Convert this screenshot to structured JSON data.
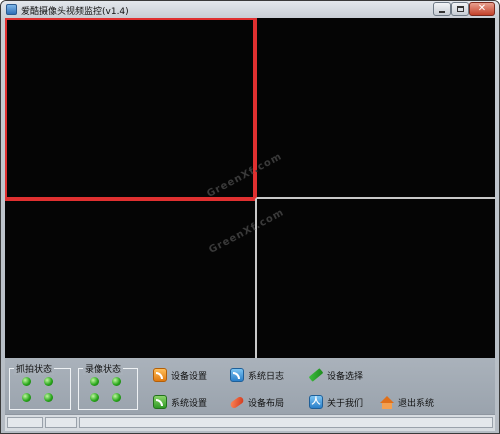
{
  "window": {
    "title": "爱酷摄像头视频监控(v1.4)",
    "icons": {
      "app": "app-icon",
      "minimize": "minimize-icon",
      "maximize": "maximize-icon",
      "close": "close-icon"
    },
    "close_glyph": "✕"
  },
  "video": {
    "panes": [
      "pane-1",
      "pane-2",
      "pane-3",
      "pane-4"
    ],
    "selected_pane": 1,
    "selected_border_color": "#e03030",
    "grid_color": "#c8c8c8",
    "watermark": "GreenXf.com"
  },
  "panel": {
    "capture_group": {
      "label": "抓拍状态",
      "indicators": 4,
      "color": "#2aa81c"
    },
    "record_group": {
      "label": "录像状态",
      "indicators": 4,
      "color": "#2aa81c"
    },
    "actions": [
      {
        "label": "设备设置",
        "icon": "rss-orange-icon"
      },
      {
        "label": "系统日志",
        "icon": "rss-blue-icon"
      },
      {
        "label": "设备选择",
        "icon": "pencil-icon"
      },
      {
        "label": "系统设置",
        "icon": "rss-green-icon"
      },
      {
        "label": "设备布局",
        "icon": "brush-icon"
      },
      {
        "label": "关于我们",
        "icon": "user-icon"
      },
      {
        "label": "退出系统",
        "icon": "home-icon"
      }
    ]
  },
  "statusbar": {
    "cells": [
      "",
      "",
      ""
    ]
  }
}
